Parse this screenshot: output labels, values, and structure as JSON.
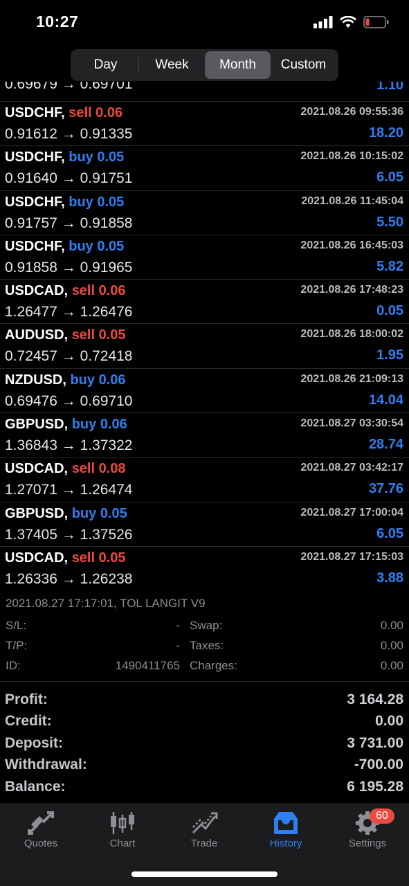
{
  "status": {
    "time": "10:27"
  },
  "period_tabs": [
    {
      "label": "Day",
      "active": false
    },
    {
      "label": "Week",
      "active": false
    },
    {
      "label": "Month",
      "active": true
    },
    {
      "label": "Custom",
      "active": false
    }
  ],
  "partial_deal": {
    "prices": "0.69679 → 0.69701",
    "profit": "1.10"
  },
  "deals": [
    {
      "symbol": "USDCHF,",
      "side": "sell",
      "volume": "0.06",
      "time": "2021.08.26 09:55:36",
      "prices": "0.91612 → 0.91335",
      "profit": "18.20"
    },
    {
      "symbol": "USDCHF,",
      "side": "buy",
      "volume": "0.05",
      "time": "2021.08.26 10:15:02",
      "prices": "0.91640 → 0.91751",
      "profit": "6.05"
    },
    {
      "symbol": "USDCHF,",
      "side": "buy",
      "volume": "0.05",
      "time": "2021.08.26 11:45:04",
      "prices": "0.91757 → 0.91858",
      "profit": "5.50"
    },
    {
      "symbol": "USDCHF,",
      "side": "buy",
      "volume": "0.05",
      "time": "2021.08.26 16:45:03",
      "prices": "0.91858 → 0.91965",
      "profit": "5.82"
    },
    {
      "symbol": "USDCAD,",
      "side": "sell",
      "volume": "0.06",
      "time": "2021.08.26 17:48:23",
      "prices": "1.26477 → 1.26476",
      "profit": "0.05"
    },
    {
      "symbol": "AUDUSD,",
      "side": "sell",
      "volume": "0.05",
      "time": "2021.08.26 18:00:02",
      "prices": "0.72457 → 0.72418",
      "profit": "1.95"
    },
    {
      "symbol": "NZDUSD,",
      "side": "buy",
      "volume": "0.06",
      "time": "2021.08.26 21:09:13",
      "prices": "0.69476 → 0.69710",
      "profit": "14.04"
    },
    {
      "symbol": "GBPUSD,",
      "side": "buy",
      "volume": "0.06",
      "time": "2021.08.27 03:30:54",
      "prices": "1.36843 → 1.37322",
      "profit": "28.74"
    },
    {
      "symbol": "USDCAD,",
      "side": "sell",
      "volume": "0.08",
      "time": "2021.08.27 03:42:17",
      "prices": "1.27071 → 1.26474",
      "profit": "37.76"
    },
    {
      "symbol": "GBPUSD,",
      "side": "buy",
      "volume": "0.05",
      "time": "2021.08.27 17:00:04",
      "prices": "1.37405 → 1.37526",
      "profit": "6.05"
    },
    {
      "symbol": "USDCAD,",
      "side": "sell",
      "volume": "0.05",
      "time": "2021.08.27 17:15:03",
      "prices": "1.26336 → 1.26238",
      "profit": "3.88"
    }
  ],
  "details": {
    "title": "2021.08.27 17:17:01, TOL LANGIT V9",
    "sl_label": "S/L:",
    "sl_value": "-",
    "tp_label": "T/P:",
    "tp_value": "-",
    "id_label": "ID:",
    "id_value": "1490411765",
    "swap_label": "Swap:",
    "swap_value": "0.00",
    "taxes_label": "Taxes:",
    "taxes_value": "0.00",
    "charges_label": "Charges:",
    "charges_value": "0.00"
  },
  "summary": [
    {
      "label": "Profit:",
      "value": "3 164.28"
    },
    {
      "label": "Credit:",
      "value": "0.00"
    },
    {
      "label": "Deposit:",
      "value": "3 731.00"
    },
    {
      "label": "Withdrawal:",
      "value": "-700.00"
    },
    {
      "label": "Balance:",
      "value": "6 195.28"
    }
  ],
  "tabbar": {
    "quotes": "Quotes",
    "chart": "Chart",
    "trade": "Trade",
    "history": "History",
    "settings": "Settings",
    "settings_badge": "60"
  },
  "colors": {
    "sell": "#ec4a3e",
    "buy": "#2f7ff0",
    "accent": "#2f7ff0"
  },
  "icons": [
    "signal-icon",
    "wifi-icon",
    "battery-icon",
    "quotes-icon",
    "chart-icon",
    "trade-icon",
    "history-icon",
    "settings-icon"
  ]
}
